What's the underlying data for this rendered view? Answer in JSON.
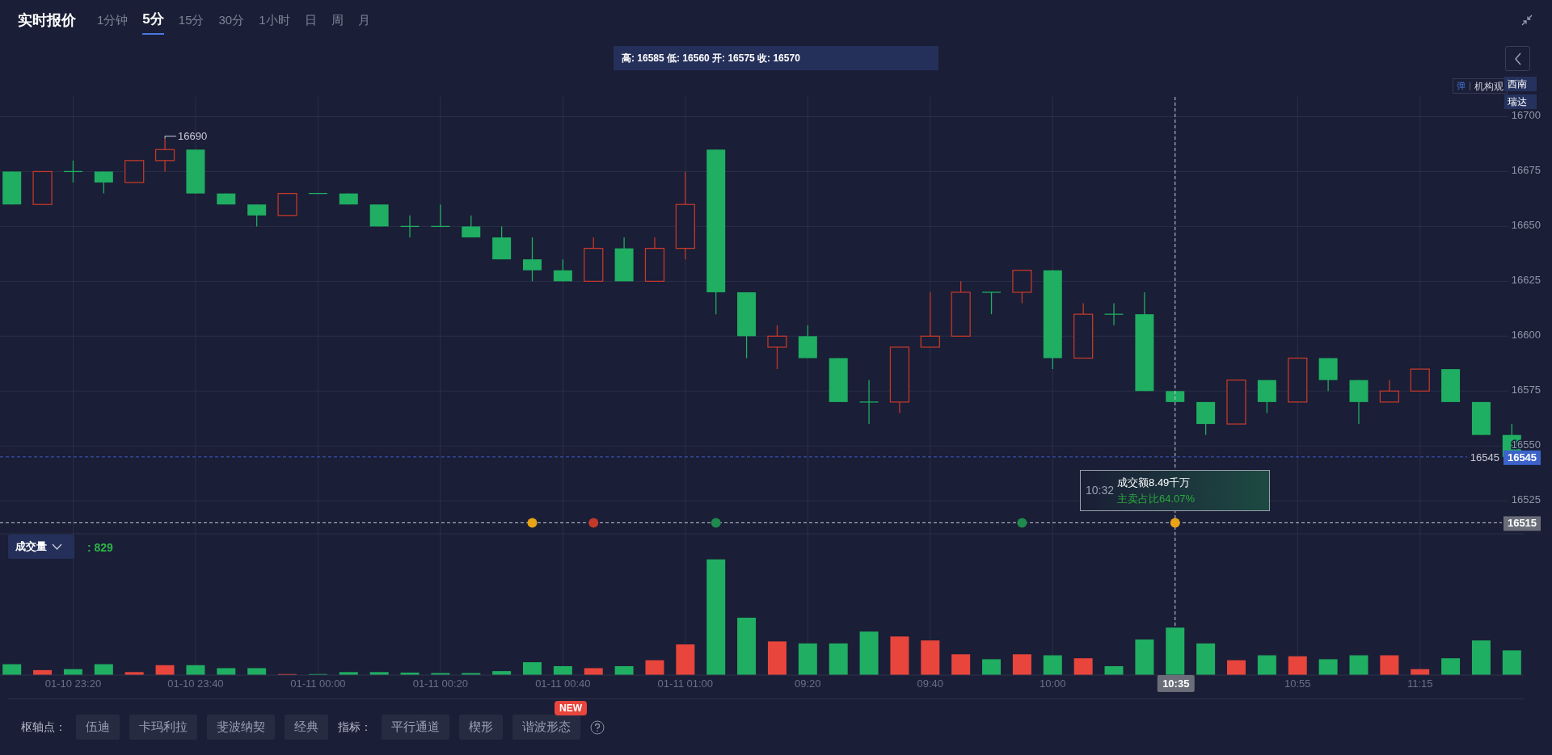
{
  "header": {
    "title": "实时报价",
    "tabs": [
      {
        "label": "1分钟",
        "selected": false
      },
      {
        "label": "5分",
        "selected": true
      },
      {
        "label": "15分",
        "selected": false
      },
      {
        "label": "30分",
        "selected": false
      },
      {
        "label": "1小时",
        "selected": false
      },
      {
        "label": "日",
        "selected": false
      },
      {
        "label": "周",
        "selected": false
      },
      {
        "label": "月",
        "selected": false
      }
    ]
  },
  "ohlc_bar": "高: 16585 低: 16560 开: 16575 收: 16570",
  "legend": {
    "icon_text": "弹",
    "label": "机构观"
  },
  "tags": [
    "西南",
    "瑞达"
  ],
  "price_chart": {
    "price_axis_labels": [
      "16700",
      "16675",
      "16650",
      "16625",
      "16600",
      "16575",
      "16550",
      "16525"
    ],
    "time_axis_labels": [
      "01-10 23:20",
      "01-10 23:40",
      "01-11 00:00",
      "01-11 00:20",
      "01-11 00:40",
      "01-11 01:00",
      "09:20",
      "09:40",
      "10:00",
      "10:55",
      "11:15"
    ],
    "high_label": "16690",
    "current_price": {
      "left_label": "16545",
      "right_label": "16545"
    },
    "crosshair": {
      "price_label": "16515",
      "time_label": "10:35"
    },
    "tooltip": {
      "time": "10:32",
      "amount": "成交额8.49千万",
      "ratio": "主卖占比64.07%"
    },
    "event_markers": [
      {
        "color": "#e8a317"
      },
      {
        "color": "#c0392b"
      },
      {
        "color": "#1f8a4c"
      },
      {
        "color": "#1f8a4c"
      },
      {
        "color": "#e8a317"
      }
    ]
  },
  "volume": {
    "selector": "成交量",
    "value": ": 829"
  },
  "toolbar": {
    "pivot_label": "枢轴点：",
    "pivot_buttons": [
      "伍迪",
      "卡玛利拉",
      "斐波纳契",
      "经典"
    ],
    "indicator_label": "指标：",
    "indicator_buttons": [
      {
        "label": "平行通道"
      },
      {
        "label": "楔形"
      },
      {
        "label": "谐波形态",
        "badge": "NEW"
      }
    ]
  }
}
